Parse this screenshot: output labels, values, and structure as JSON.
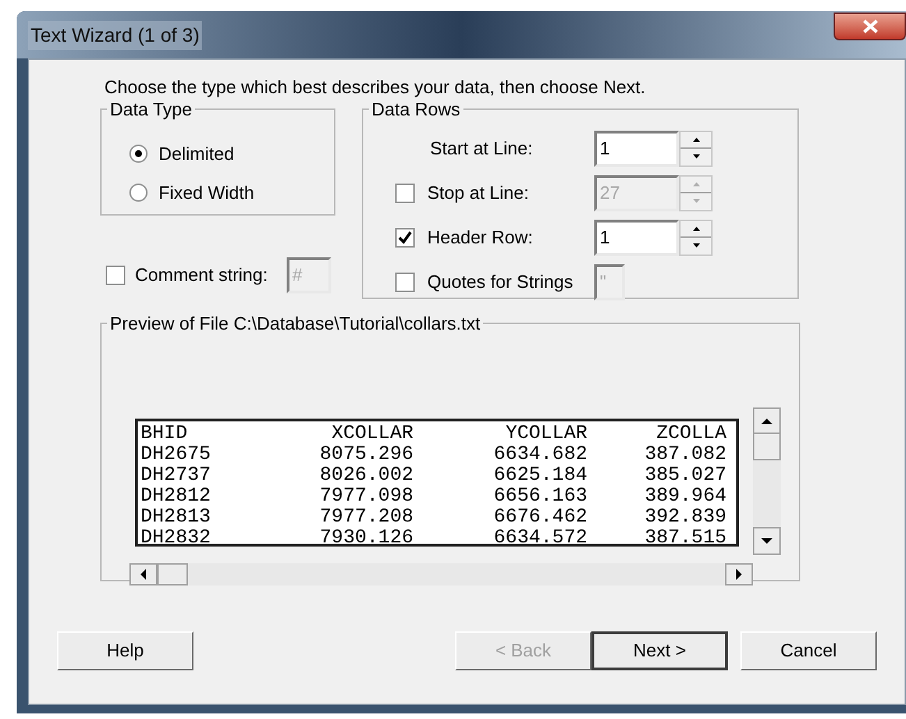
{
  "window": {
    "title": "Text Wizard (1 of 3)"
  },
  "instruction": "Choose the type which best describes your data, then choose Next.",
  "data_type": {
    "label": "Data Type",
    "options": [
      {
        "label": "Delimited",
        "selected": true
      },
      {
        "label": "Fixed Width",
        "selected": false
      }
    ]
  },
  "comment": {
    "label": "Comment string:",
    "checked": false,
    "value": "#",
    "disabled": true
  },
  "data_rows": {
    "label": "Data Rows",
    "fields": [
      {
        "kind": "spin",
        "label": "Start at Line:",
        "value": "1",
        "disabled": false
      },
      {
        "kind": "check_spin",
        "label": "Stop at Line:",
        "checked": false,
        "value": "27",
        "disabled": true
      },
      {
        "kind": "check_spin",
        "label": "Header Row:",
        "checked": true,
        "value": "1",
        "disabled": false
      },
      {
        "kind": "check_text",
        "label": "Quotes for Strings",
        "checked": false,
        "value": "\"",
        "disabled": true
      }
    ]
  },
  "preview": {
    "label": "Preview of File C:\\Database\\Tutorial\\collars.txt",
    "columns": [
      "BHID",
      "XCOLLAR",
      "YCOLLAR",
      "ZCOLLA"
    ],
    "rows": [
      [
        "DH2675",
        "8075.296",
        "6634.682",
        "387.082"
      ],
      [
        "DH2737",
        "8026.002",
        "6625.184",
        "385.027"
      ],
      [
        "DH2812",
        "7977.098",
        "6656.163",
        "389.964"
      ],
      [
        "DH2813",
        "7977.208",
        "6676.462",
        "392.839"
      ],
      [
        "DH2832",
        "7930.126",
        "6634.572",
        "387.515"
      ]
    ]
  },
  "buttons": [
    {
      "label": "Help",
      "disabled": false,
      "default": false
    },
    {
      "label": "< Back",
      "disabled": true,
      "default": false
    },
    {
      "label": "Next >",
      "disabled": false,
      "default": true
    },
    {
      "label": "Cancel",
      "disabled": false,
      "default": false
    }
  ]
}
